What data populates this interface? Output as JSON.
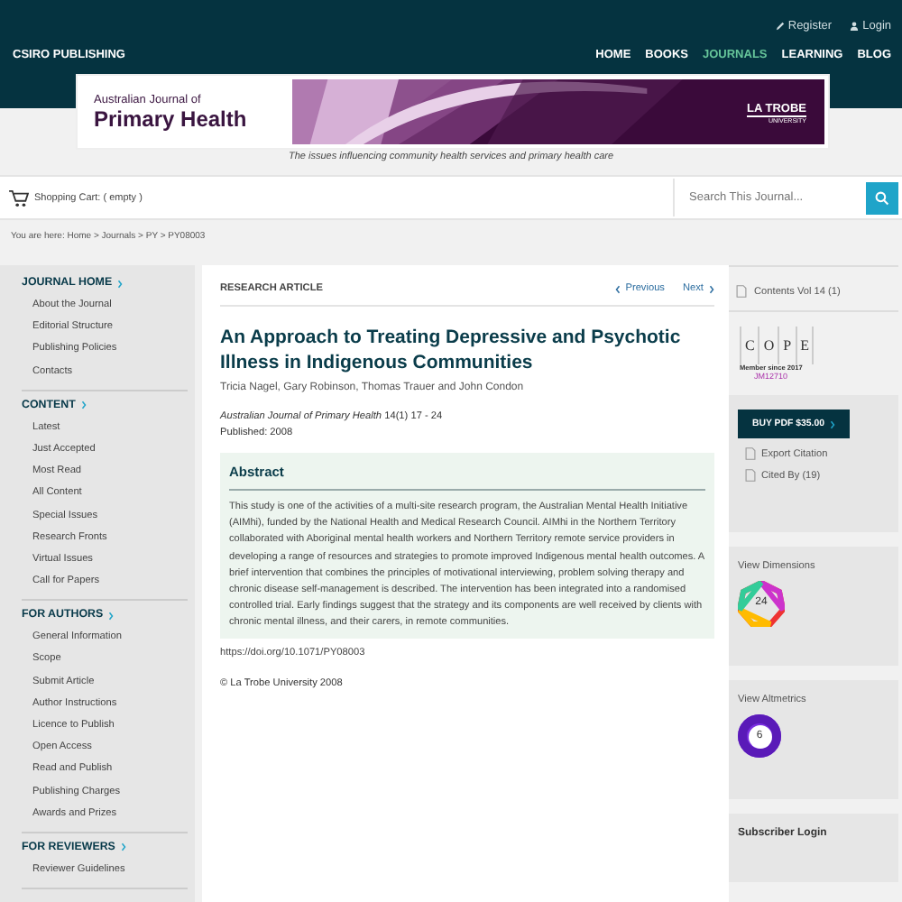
{
  "top_links": [
    "Register",
    "Login"
  ],
  "brand": "CSIRO PUBLISHING",
  "nav": [
    {
      "label": "HOME",
      "selected": false
    },
    {
      "label": "BOOKS",
      "selected": false
    },
    {
      "label": "JOURNALS",
      "selected": true
    },
    {
      "label": "LEARNING",
      "selected": false
    },
    {
      "label": "BLOG",
      "selected": false
    }
  ],
  "banner": {
    "title_small": "Australian Journal of",
    "title_large": "Primary Health",
    "logo_main": "LA TROBE",
    "logo_sub": "UNIVERSITY"
  },
  "tagline": "The issues influencing community health services and primary health care",
  "cart": "Shopping Cart: ( empty )",
  "search": {
    "placeholder": "Search This Journal..."
  },
  "breadcrumb": "You are here: Home > Journals > PY > PY08003",
  "sidebar": [
    {
      "heading": "JOURNAL HOME",
      "items": [
        "About the Journal",
        "Editorial Structure",
        "Publishing Policies",
        "Contacts"
      ]
    },
    {
      "heading": "CONTENT",
      "items": [
        "Latest",
        "Just Accepted",
        "Most Read",
        "All Content",
        "Special Issues",
        "Research Fronts",
        "Virtual Issues",
        "Call for Papers"
      ]
    },
    {
      "heading": "FOR AUTHORS",
      "items": [
        "General Information",
        "Scope",
        "Submit Article",
        "Author Instructions",
        "Licence to Publish",
        "Open Access",
        "Read and Publish",
        "Publishing Charges",
        "Awards and Prizes"
      ]
    },
    {
      "heading": "FOR REVIEWERS",
      "items": [
        "Reviewer Guidelines"
      ]
    }
  ],
  "article": {
    "type": "RESEARCH ARTICLE",
    "previous": "Previous",
    "next": "Next",
    "title": "An Approach to Treating Depressive and Psychotic Illness in Indigenous Communities",
    "authors": "Tricia Nagel, Gary Robinson, Thomas Trauer and John Condon",
    "citation": "*Australian Journal of Primary Health* 14(1) 17 - 24",
    "published": "Published: 2008",
    "abstract_heading": "Abstract",
    "abstract": "This study is one of the activities of a multi-site research program, the Australian Mental Health Initiative (AIMhi), funded by the National Health and Medical Research Council. AIMhi in the Northern Territory collaborated with Aboriginal mental health workers and Northern Territory remote service providers in developing a range of resources and strategies to promote improved Indigenous mental health outcomes. A brief intervention that combines the principles of motivational interviewing, problem solving therapy and chronic disease self-management is described. The intervention has been integrated into a randomised controlled trial. Early findings suggest that the strategy and its components are well received by clients with chronic mental illness, and their carers, in remote communities.",
    "doi": "https://doi.org/10.1071/PY08003",
    "copyright": "© La Trobe University 2008"
  },
  "aside": {
    "contents": "Contents Vol 14 (1)",
    "cope": {
      "letters": [
        "C",
        "O",
        "P",
        "E"
      ],
      "member": "Member since 2017",
      "code": "JM12710"
    },
    "buy": "BUY PDF $35.00",
    "links": [
      "Export Citation",
      "Cited By (19)"
    ],
    "dimensions": {
      "label": "View Dimensions",
      "count": "24"
    },
    "altmetrics": {
      "label": "View Altmetrics",
      "score": "6"
    },
    "subscriber": "Subscriber Login"
  }
}
